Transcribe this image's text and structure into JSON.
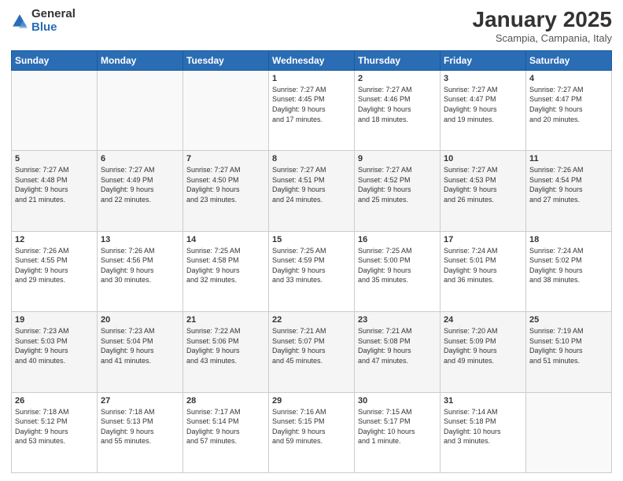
{
  "logo": {
    "general": "General",
    "blue": "Blue"
  },
  "header": {
    "month": "January 2025",
    "location": "Scampia, Campania, Italy"
  },
  "days_of_week": [
    "Sunday",
    "Monday",
    "Tuesday",
    "Wednesday",
    "Thursday",
    "Friday",
    "Saturday"
  ],
  "weeks": [
    [
      {
        "day": "",
        "info": ""
      },
      {
        "day": "",
        "info": ""
      },
      {
        "day": "",
        "info": ""
      },
      {
        "day": "1",
        "info": "Sunrise: 7:27 AM\nSunset: 4:45 PM\nDaylight: 9 hours\nand 17 minutes."
      },
      {
        "day": "2",
        "info": "Sunrise: 7:27 AM\nSunset: 4:46 PM\nDaylight: 9 hours\nand 18 minutes."
      },
      {
        "day": "3",
        "info": "Sunrise: 7:27 AM\nSunset: 4:47 PM\nDaylight: 9 hours\nand 19 minutes."
      },
      {
        "day": "4",
        "info": "Sunrise: 7:27 AM\nSunset: 4:47 PM\nDaylight: 9 hours\nand 20 minutes."
      }
    ],
    [
      {
        "day": "5",
        "info": "Sunrise: 7:27 AM\nSunset: 4:48 PM\nDaylight: 9 hours\nand 21 minutes."
      },
      {
        "day": "6",
        "info": "Sunrise: 7:27 AM\nSunset: 4:49 PM\nDaylight: 9 hours\nand 22 minutes."
      },
      {
        "day": "7",
        "info": "Sunrise: 7:27 AM\nSunset: 4:50 PM\nDaylight: 9 hours\nand 23 minutes."
      },
      {
        "day": "8",
        "info": "Sunrise: 7:27 AM\nSunset: 4:51 PM\nDaylight: 9 hours\nand 24 minutes."
      },
      {
        "day": "9",
        "info": "Sunrise: 7:27 AM\nSunset: 4:52 PM\nDaylight: 9 hours\nand 25 minutes."
      },
      {
        "day": "10",
        "info": "Sunrise: 7:27 AM\nSunset: 4:53 PM\nDaylight: 9 hours\nand 26 minutes."
      },
      {
        "day": "11",
        "info": "Sunrise: 7:26 AM\nSunset: 4:54 PM\nDaylight: 9 hours\nand 27 minutes."
      }
    ],
    [
      {
        "day": "12",
        "info": "Sunrise: 7:26 AM\nSunset: 4:55 PM\nDaylight: 9 hours\nand 29 minutes."
      },
      {
        "day": "13",
        "info": "Sunrise: 7:26 AM\nSunset: 4:56 PM\nDaylight: 9 hours\nand 30 minutes."
      },
      {
        "day": "14",
        "info": "Sunrise: 7:25 AM\nSunset: 4:58 PM\nDaylight: 9 hours\nand 32 minutes."
      },
      {
        "day": "15",
        "info": "Sunrise: 7:25 AM\nSunset: 4:59 PM\nDaylight: 9 hours\nand 33 minutes."
      },
      {
        "day": "16",
        "info": "Sunrise: 7:25 AM\nSunset: 5:00 PM\nDaylight: 9 hours\nand 35 minutes."
      },
      {
        "day": "17",
        "info": "Sunrise: 7:24 AM\nSunset: 5:01 PM\nDaylight: 9 hours\nand 36 minutes."
      },
      {
        "day": "18",
        "info": "Sunrise: 7:24 AM\nSunset: 5:02 PM\nDaylight: 9 hours\nand 38 minutes."
      }
    ],
    [
      {
        "day": "19",
        "info": "Sunrise: 7:23 AM\nSunset: 5:03 PM\nDaylight: 9 hours\nand 40 minutes."
      },
      {
        "day": "20",
        "info": "Sunrise: 7:23 AM\nSunset: 5:04 PM\nDaylight: 9 hours\nand 41 minutes."
      },
      {
        "day": "21",
        "info": "Sunrise: 7:22 AM\nSunset: 5:06 PM\nDaylight: 9 hours\nand 43 minutes."
      },
      {
        "day": "22",
        "info": "Sunrise: 7:21 AM\nSunset: 5:07 PM\nDaylight: 9 hours\nand 45 minutes."
      },
      {
        "day": "23",
        "info": "Sunrise: 7:21 AM\nSunset: 5:08 PM\nDaylight: 9 hours\nand 47 minutes."
      },
      {
        "day": "24",
        "info": "Sunrise: 7:20 AM\nSunset: 5:09 PM\nDaylight: 9 hours\nand 49 minutes."
      },
      {
        "day": "25",
        "info": "Sunrise: 7:19 AM\nSunset: 5:10 PM\nDaylight: 9 hours\nand 51 minutes."
      }
    ],
    [
      {
        "day": "26",
        "info": "Sunrise: 7:18 AM\nSunset: 5:12 PM\nDaylight: 9 hours\nand 53 minutes."
      },
      {
        "day": "27",
        "info": "Sunrise: 7:18 AM\nSunset: 5:13 PM\nDaylight: 9 hours\nand 55 minutes."
      },
      {
        "day": "28",
        "info": "Sunrise: 7:17 AM\nSunset: 5:14 PM\nDaylight: 9 hours\nand 57 minutes."
      },
      {
        "day": "29",
        "info": "Sunrise: 7:16 AM\nSunset: 5:15 PM\nDaylight: 9 hours\nand 59 minutes."
      },
      {
        "day": "30",
        "info": "Sunrise: 7:15 AM\nSunset: 5:17 PM\nDaylight: 10 hours\nand 1 minute."
      },
      {
        "day": "31",
        "info": "Sunrise: 7:14 AM\nSunset: 5:18 PM\nDaylight: 10 hours\nand 3 minutes."
      },
      {
        "day": "",
        "info": ""
      }
    ]
  ]
}
